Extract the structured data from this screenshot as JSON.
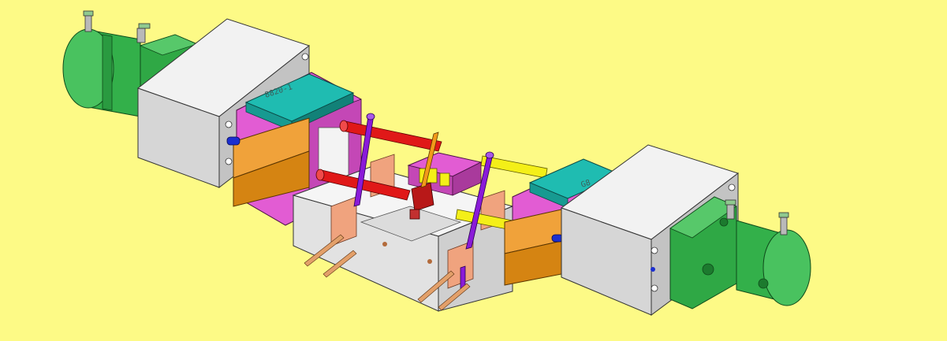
{
  "scene": {
    "background_color": "#fdfa86",
    "engraved_labels": {
      "left_plate": "8820-1",
      "right_plate": "G8"
    },
    "colors": {
      "cylinder_green": "#2fae45",
      "block_gray": "#d8d8d8",
      "plate_teal": "#1fbcb1",
      "frame_magenta": "#e455d4",
      "slide_orange": "#e08a10",
      "pin_purple": "#8a1bd8",
      "rod_red": "#e01818",
      "rod_yellow": "#f4f018",
      "core_salmon": "#f4a47a",
      "base_white": "#e9e9e9",
      "insert_red": "#b81818"
    }
  }
}
